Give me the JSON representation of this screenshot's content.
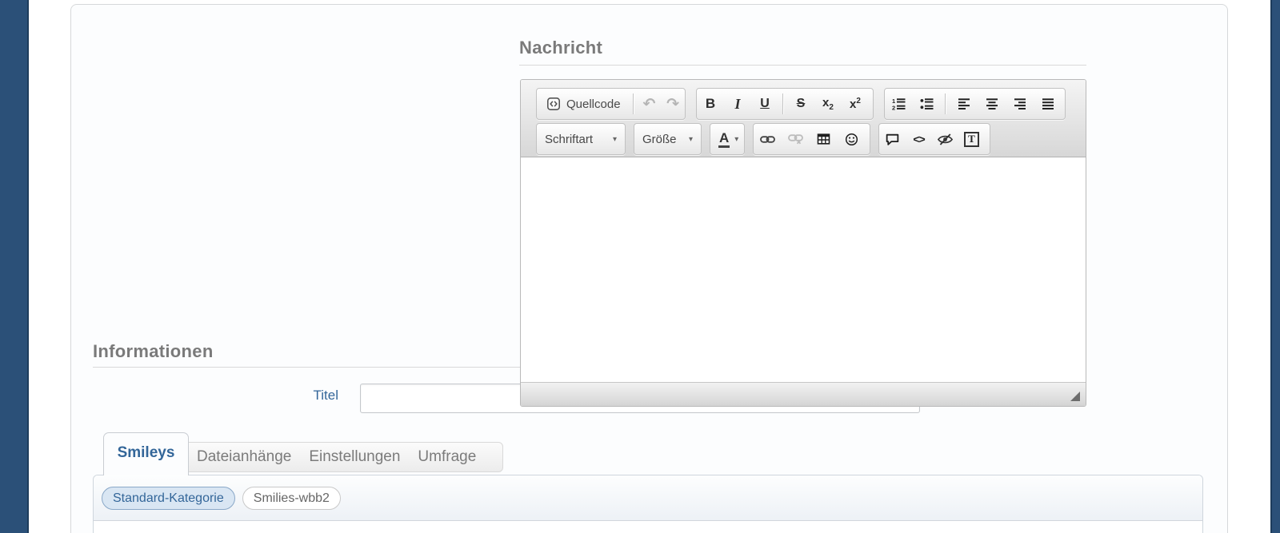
{
  "page": {
    "background": "#ffffff",
    "sidebar_color": "#2b5078",
    "accent": "#336699"
  },
  "message_section": {
    "heading": "Nachricht",
    "editor_content": ""
  },
  "toolbar": {
    "source_label": "Quellcode",
    "undo_glyph": "↶",
    "redo_glyph": "↷",
    "bold_glyph": "B",
    "italic_glyph": "I",
    "underline_glyph": "U",
    "strike_glyph": "S",
    "script_base": "x",
    "script_digit": "2",
    "font_dropdown_label": "Schriftart",
    "size_dropdown_label": "Größe",
    "color_button_glyph": "A",
    "caret_glyph": "▾",
    "code_glyph": "<>",
    "tt_glyph": "T"
  },
  "info_section": {
    "heading": "Informationen",
    "titel_label": "Titel",
    "titel_value": ""
  },
  "tab_menu": {
    "tabs": [
      {
        "label": "Smileys",
        "active": true
      },
      {
        "label": "Dateianhänge",
        "active": false
      },
      {
        "label": "Einstellungen",
        "active": false
      },
      {
        "label": "Umfrage",
        "active": false
      }
    ]
  },
  "smiley_categories": [
    {
      "label": "Standard-Kategorie",
      "active": true
    },
    {
      "label": "Smilies-wbb2",
      "active": false
    }
  ]
}
